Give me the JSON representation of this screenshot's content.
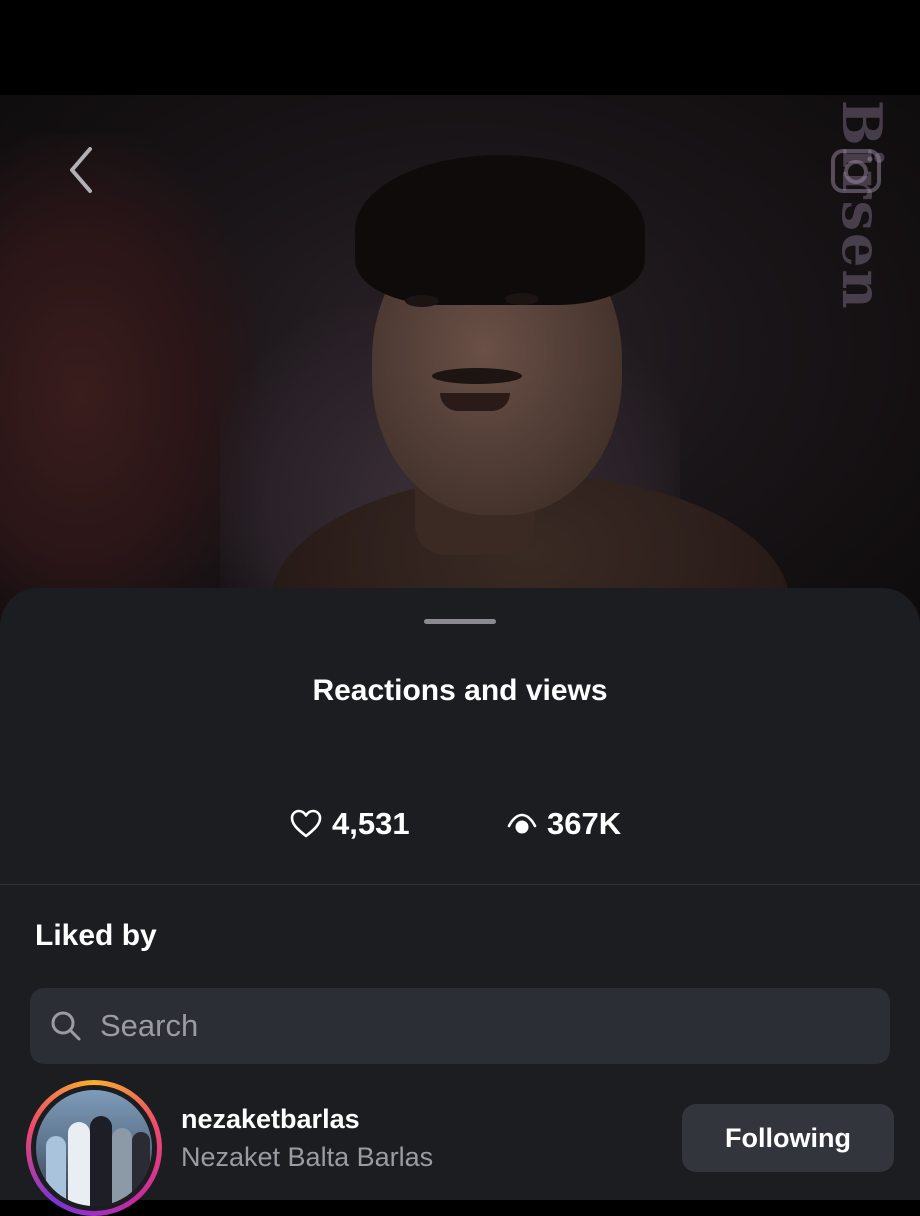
{
  "story": {
    "watermark_text": "Birsen",
    "icons": {
      "back": "chevron-left-icon",
      "watermark": "camera-icon"
    }
  },
  "sheet": {
    "title": "Reactions and views",
    "likes_count": "4,531",
    "views_count": "367K",
    "liked_by_label": "Liked by",
    "search_placeholder": "Search",
    "icons": {
      "likes": "heart-icon",
      "views": "eye-icon",
      "search": "search-icon"
    },
    "users": [
      {
        "username": "nezaketbarlas",
        "full_name": "Nezaket Balta Barlas",
        "button_label": "Following",
        "has_story_ring": true
      }
    ]
  },
  "colors": {
    "background": "#000000",
    "sheet": "#1c1d21",
    "search_field": "#2c2e36",
    "button": "#33353d",
    "secondary_text": "#9a9ba3"
  }
}
